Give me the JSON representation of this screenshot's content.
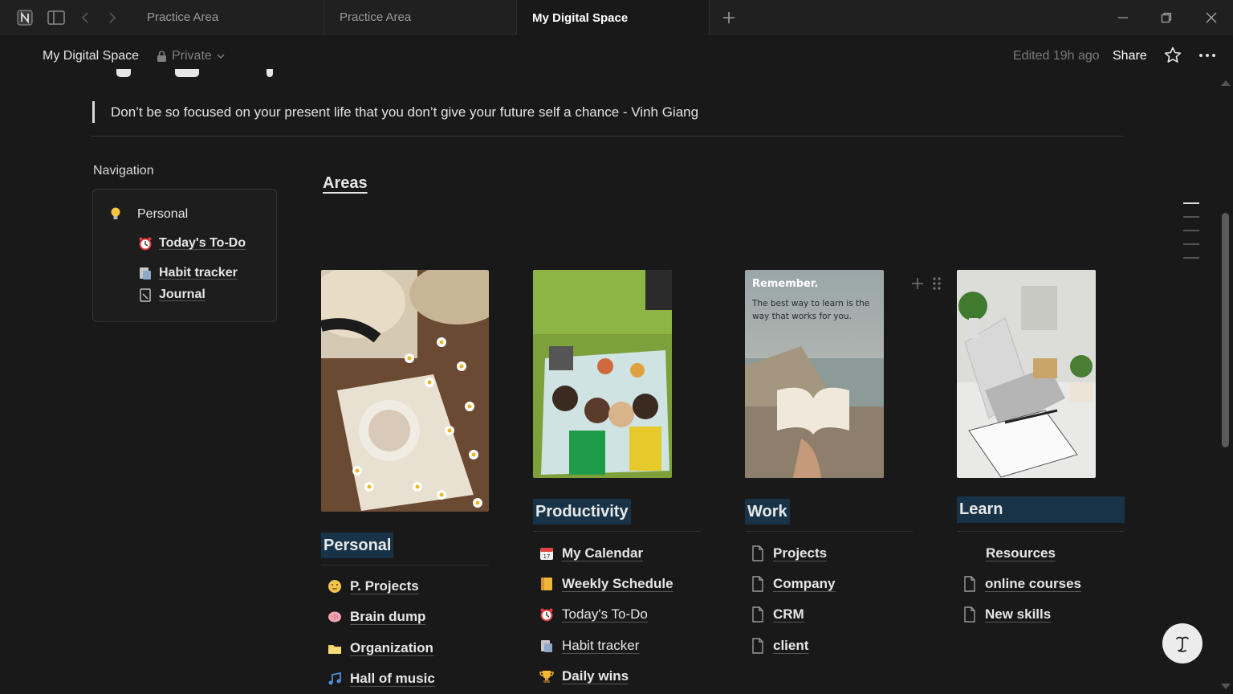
{
  "tabs": [
    {
      "label": "Practice Area"
    },
    {
      "label": "Practice Area"
    },
    {
      "label": "My Digital Space"
    }
  ],
  "topbar": {
    "breadcrumb": "My Digital Space",
    "privacy": "Private",
    "edited": "Edited 19h ago",
    "share": "Share"
  },
  "quote": "Don’t be so focused on your present life that you don’t give your future self a chance - Vinh Giang",
  "navigation": {
    "title": "Navigation",
    "parent": "Personal",
    "items": [
      {
        "label": "Today's To-Do",
        "icon": "alarm-clock-icon"
      },
      {
        "label": "Habit tracker",
        "icon": "habit-icon"
      },
      {
        "label": "Journal",
        "icon": "journal-icon"
      }
    ]
  },
  "areas": {
    "title": "Areas",
    "image_text": {
      "heading": "Remember.",
      "body": "The best way to learn is the way that works for you."
    },
    "columns": [
      {
        "title": "Personal",
        "items": [
          {
            "label": "P. Projects",
            "icon": "thinking-face-icon"
          },
          {
            "label": "Brain dump",
            "icon": "brain-icon"
          },
          {
            "label": "Organization",
            "icon": "folder-icon"
          },
          {
            "label": "Hall of music",
            "icon": "music-notes-icon"
          }
        ]
      },
      {
        "title": "Productivity",
        "items": [
          {
            "label": "My Calendar",
            "icon": "calendar-icon"
          },
          {
            "label": "Weekly Schedule",
            "icon": "ledger-icon"
          },
          {
            "label": "Today's To-Do",
            "icon": "alarm-clock-icon"
          },
          {
            "label": "Habit tracker",
            "icon": "habit-icon"
          },
          {
            "label": "Daily wins",
            "icon": "trophy-icon"
          }
        ]
      },
      {
        "title": "Work",
        "items": [
          {
            "label": "Projects",
            "icon": "page-icon"
          },
          {
            "label": "Company",
            "icon": "page-icon"
          },
          {
            "label": "CRM",
            "icon": "page-icon"
          },
          {
            "label": "client",
            "icon": "page-icon"
          }
        ]
      },
      {
        "title": "Learn",
        "items": [
          {
            "label": "Resources",
            "icon": ""
          },
          {
            "label": "online courses",
            "icon": "page-icon"
          },
          {
            "label": "New skills",
            "icon": "page-icon"
          }
        ]
      }
    ]
  },
  "colors": {
    "accent_highlight": "#183347",
    "background": "#191919"
  }
}
